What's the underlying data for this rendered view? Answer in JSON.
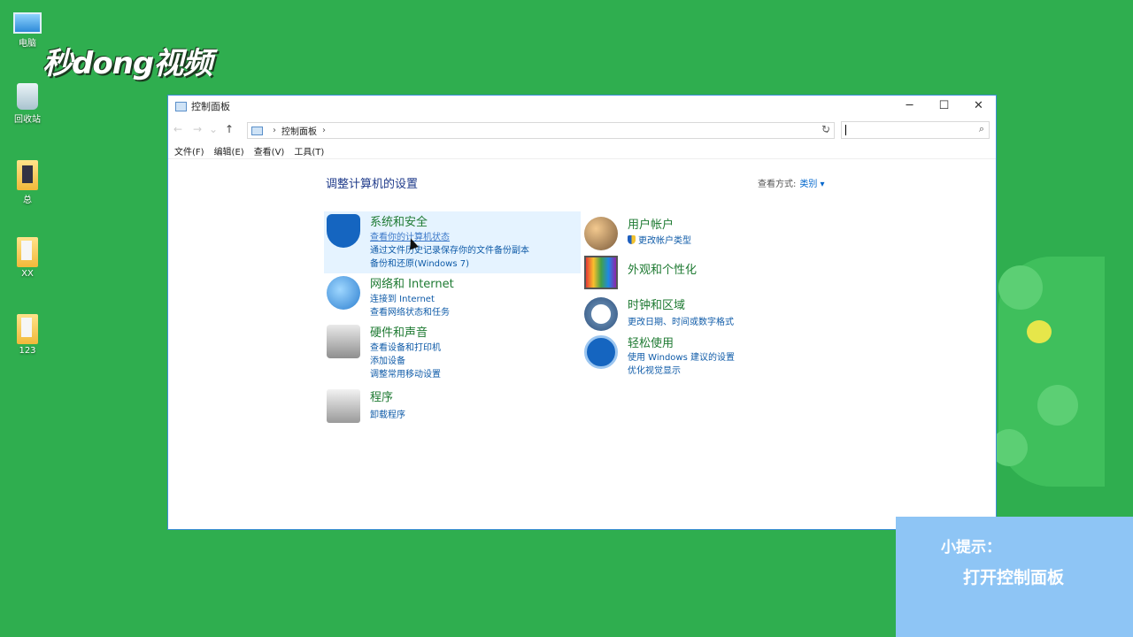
{
  "desktop": {
    "icons": [
      {
        "label": "电脑",
        "icon": "computer-icon"
      },
      {
        "label": "回收站",
        "icon": "recycle-bin-icon"
      },
      {
        "label": "总",
        "icon": "folder-icon"
      },
      {
        "label": "XX",
        "icon": "folder-icon"
      },
      {
        "label": "123",
        "icon": "folder-icon"
      }
    ]
  },
  "window": {
    "title": "控制面板",
    "controls": {
      "minimize": "─",
      "maximize": "☐",
      "close": "✕"
    },
    "nav": {
      "back": "←",
      "forward": "→",
      "recent": "⌄",
      "up": "↑"
    },
    "address": {
      "root_sep": "›",
      "crumb": "控制面板",
      "trail_sep": "›",
      "dropdown": "⌄",
      "refresh": "↻"
    },
    "search": {
      "placeholder": "",
      "icon": "⌕"
    },
    "menu": [
      "文件(F)",
      "编辑(E)",
      "查看(V)",
      "工具(T)"
    ]
  },
  "content": {
    "heading": "调整计算机的设置",
    "view_by_label": "查看方式:",
    "view_by_value": "类别 ▾",
    "left": [
      {
        "title": "系统和安全",
        "icon": "shield-icon",
        "links": [
          "查看你的计算机状态",
          "通过文件历史记录保存你的文件备份副本",
          "备份和还原(Windows 7)"
        ]
      },
      {
        "title": "网络和 Internet",
        "icon": "network-globe-icon",
        "links": [
          "连接到 Internet",
          "查看网络状态和任务"
        ]
      },
      {
        "title": "硬件和声音",
        "icon": "printer-icon",
        "links": [
          "查看设备和打印机",
          "添加设备",
          "调整常用移动设置"
        ]
      },
      {
        "title": "程序",
        "icon": "programs-box-icon",
        "links": [
          "卸载程序"
        ]
      }
    ],
    "right": [
      {
        "title": "用户帐户",
        "icon": "users-icon",
        "links": [
          "更改帐户类型"
        ]
      },
      {
        "title": "外观和个性化",
        "icon": "appearance-monitor-icon",
        "links": []
      },
      {
        "title": "时钟和区域",
        "icon": "clock-globe-icon",
        "links": [
          "更改日期、时间或数字格式"
        ]
      },
      {
        "title": "轻松使用",
        "icon": "ease-of-access-icon",
        "links": [
          "使用 Windows 建议的设置",
          "优化视觉显示"
        ]
      }
    ]
  },
  "overlay": {
    "tip_label": "小提示：",
    "tip_text": "打开控制面板"
  },
  "colors": {
    "desktop": "#2fae4f",
    "accent": "#1565c0",
    "category_title": "#1e7a32",
    "link": "#0f5ba8",
    "tip_bg": "#8ec5f5"
  }
}
